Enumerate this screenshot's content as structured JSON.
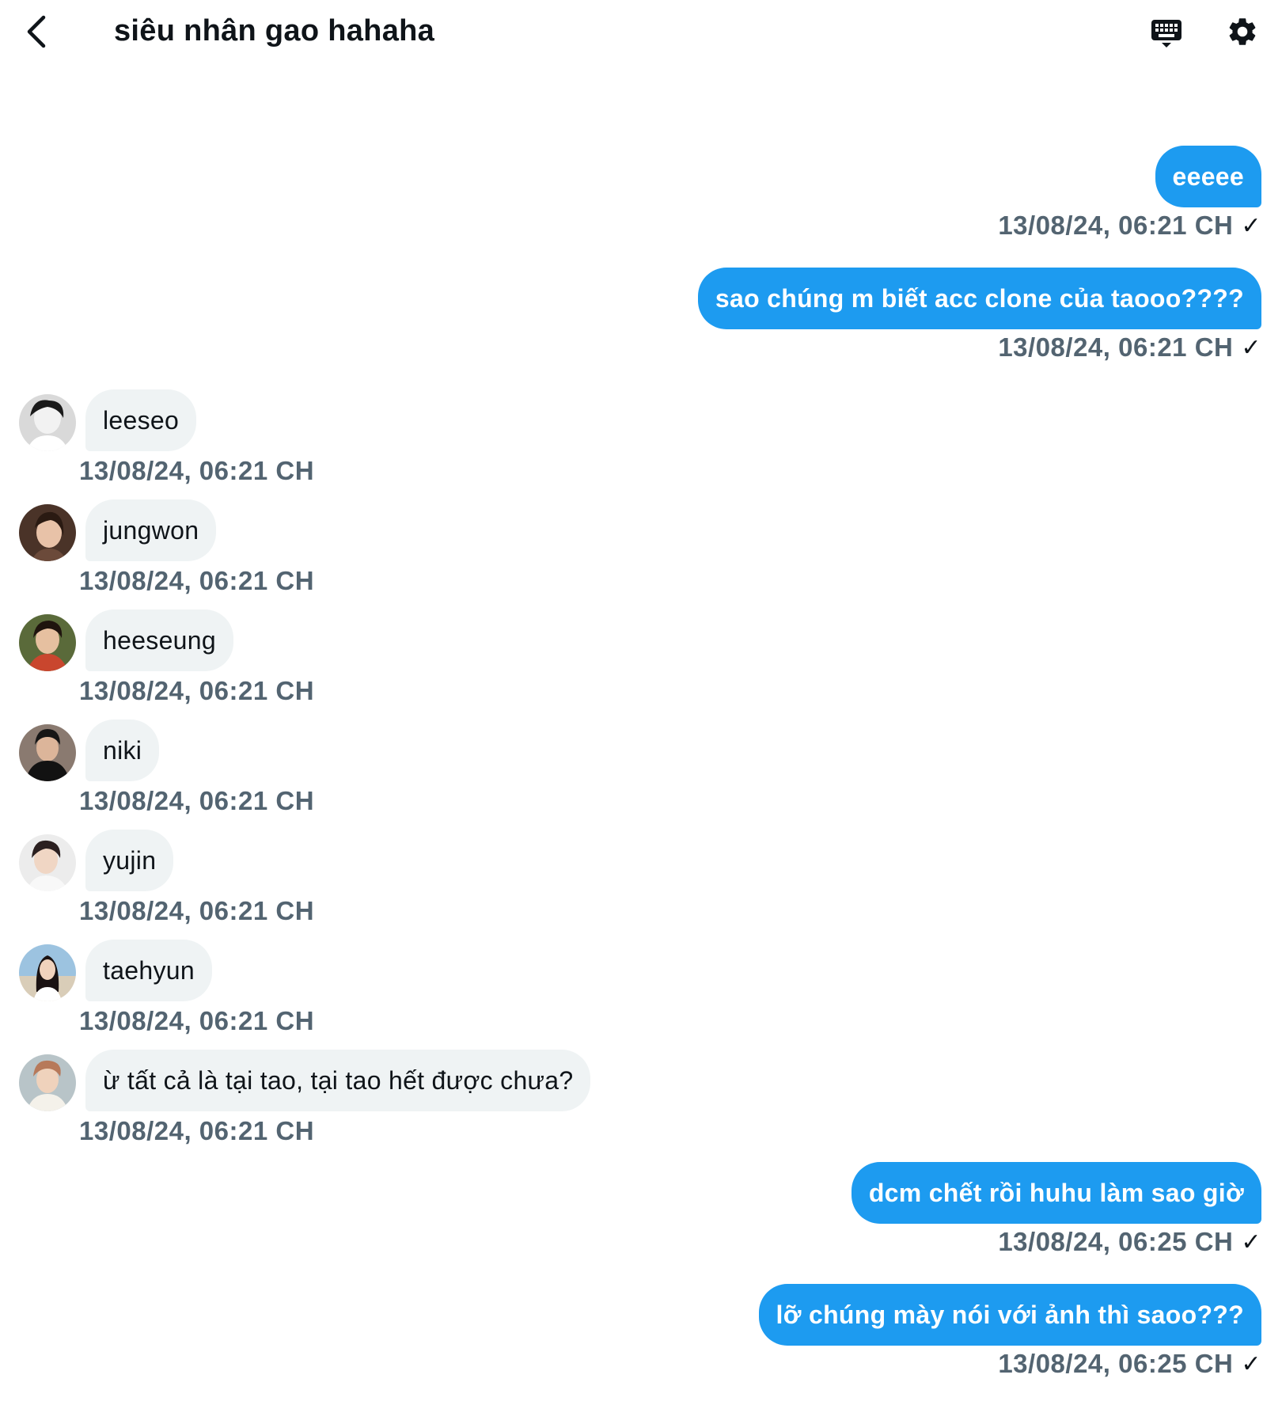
{
  "header": {
    "title": "siêu nhân gao hahaha"
  },
  "messages": [
    {
      "direction": "out",
      "text": "eeeee",
      "time": "13/08/24, 06:21 CH",
      "status": "✓"
    },
    {
      "direction": "out",
      "text": "sao chúng m biết acc clone của taooo????",
      "time": "13/08/24, 06:21 CH",
      "status": "✓"
    },
    {
      "direction": "in",
      "text": "leeseo",
      "time": "13/08/24, 06:21 CH"
    },
    {
      "direction": "in",
      "text": "jungwon",
      "time": "13/08/24, 06:21 CH"
    },
    {
      "direction": "in",
      "text": "heeseung",
      "time": "13/08/24, 06:21 CH"
    },
    {
      "direction": "in",
      "text": "niki",
      "time": "13/08/24, 06:21 CH"
    },
    {
      "direction": "in",
      "text": "yujin",
      "time": "13/08/24, 06:21 CH"
    },
    {
      "direction": "in",
      "text": "taehyun",
      "time": "13/08/24, 06:21 CH"
    },
    {
      "direction": "in",
      "text": "ừ tất cả là tại tao, tại tao hết được chưa?",
      "time": "13/08/24, 06:21 CH"
    },
    {
      "direction": "out",
      "text": "dcm chết rồi huhu làm sao giờ",
      "time": "13/08/24, 06:25 CH",
      "status": "✓"
    },
    {
      "direction": "out",
      "text": "lỡ chúng mày nói với ảnh thì saoo???",
      "time": "13/08/24, 06:25 CH",
      "status": "✓"
    }
  ],
  "colors": {
    "accent": "#1d9bf0",
    "incoming_bubble": "#eff3f4",
    "timestamp": "#536471"
  }
}
